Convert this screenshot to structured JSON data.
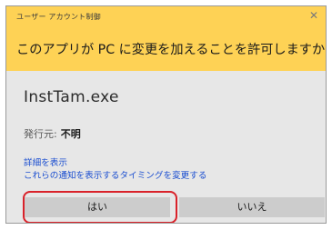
{
  "dialog": {
    "title": "ユーザー アカウント制御",
    "close_glyph": "✕",
    "question": "このアプリが PC に変更を加えることを許可しますか?",
    "header_color": "#fed255",
    "body_color": "#e7e7e7"
  },
  "app": {
    "name": "InstTam.exe",
    "publisher_label": "発行元:",
    "publisher_value": "不明"
  },
  "links": {
    "details": "詳細を表示",
    "notify": "これらの通知を表示するタイミングを変更する"
  },
  "buttons": {
    "yes_label": "はい",
    "no_label": "いいえ"
  },
  "annotation": {
    "highlight_color": "#d9222a",
    "highlighted": "yes-button"
  }
}
